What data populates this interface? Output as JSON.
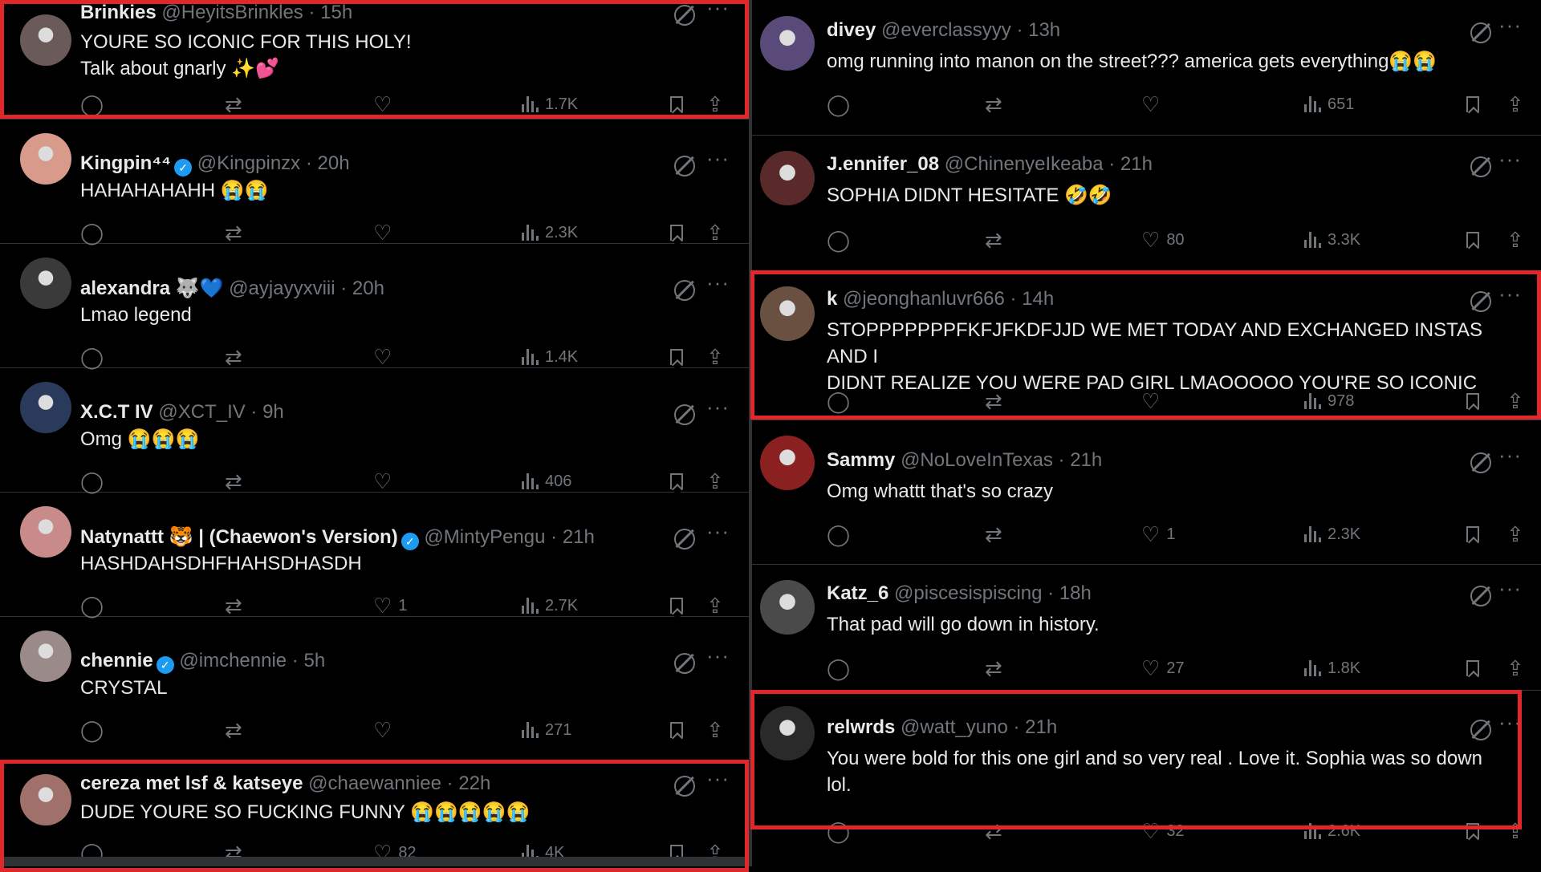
{
  "left_tweets": [
    {
      "name": "Brinkies",
      "verified": false,
      "handle": "@HeyitsBrinkles",
      "time": "15h",
      "lines": [
        "YOURE SO ICONIC FOR THIS HOLY!",
        "Talk about gnarly ✨💕"
      ],
      "replies": "",
      "retweets": "",
      "likes": "",
      "views": "1.7K",
      "avatar_color": "#6a5a5a"
    },
    {
      "name": "Kingpin⁴⁴",
      "verified": true,
      "handle": "@Kingpinzx",
      "time": "20h",
      "lines": [
        "HAHAHAHAHH 😭😭"
      ],
      "replies": "",
      "retweets": "",
      "likes": "",
      "views": "2.3K",
      "avatar_color": "#d89a8a"
    },
    {
      "name": "alexandra 🐺💙",
      "verified": false,
      "handle": "@ayjayyxviii",
      "time": "20h",
      "lines": [
        "Lmao legend"
      ],
      "replies": "",
      "retweets": "",
      "likes": "",
      "views": "1.4K",
      "avatar_color": "#3a3a3a"
    },
    {
      "name": "X.C.T IV",
      "verified": false,
      "handle": "@XCT_IV",
      "time": "9h",
      "lines": [
        "Omg 😭😭😭"
      ],
      "replies": "",
      "retweets": "",
      "likes": "",
      "views": "406",
      "avatar_color": "#2a3a5a"
    },
    {
      "name": "Natynattt 🐯 | (Chaewon's Version)",
      "verified": true,
      "handle": "@MintyPengu",
      "time": "21h",
      "lines": [
        "HASHDAHSDHFHAHSDHASDH"
      ],
      "replies": "",
      "retweets": "",
      "likes": "1",
      "views": "2.7K",
      "avatar_color": "#c98a8a"
    },
    {
      "name": "chennie",
      "verified": true,
      "handle": "@imchennie",
      "time": "5h",
      "lines": [
        "CRYSTAL"
      ],
      "replies": "",
      "retweets": "",
      "likes": "",
      "views": "271",
      "avatar_color": "#9a8a8a"
    },
    {
      "name": "cereza met lsf & katseye",
      "verified": false,
      "handle": "@chaewanniee",
      "time": "22h",
      "lines": [
        "DUDE YOURE SO FUCKING FUNNY 😭😭😭😭😭"
      ],
      "replies": "",
      "retweets": "",
      "likes": "82",
      "views": "4K",
      "avatar_color": "#a0706a"
    }
  ],
  "right_tweets": [
    {
      "name": "divey",
      "verified": false,
      "handle": "@everclassyyy",
      "time": "13h",
      "lines": [
        "omg running into manon on the street??? america gets everything😭😭"
      ],
      "replies": "",
      "retweets": "",
      "likes": "",
      "views": "651",
      "avatar_color": "#5a4a7a"
    },
    {
      "name": "J.ennifer_08",
      "verified": false,
      "handle": "@ChinenyeIkeaba",
      "time": "21h",
      "lines": [
        "SOPHIA DIDNT HESITATE 🤣🤣"
      ],
      "replies": "",
      "retweets": "",
      "likes": "80",
      "views": "3.3K",
      "avatar_color": "#5a2a2a"
    },
    {
      "name": "k",
      "verified": false,
      "handle": "@jeonghanluvr666",
      "time": "14h",
      "lines": [
        "STOPPPPPPPFKFJFKDFJJD WE MET TODAY AND EXCHANGED INSTAS AND I",
        "DIDNT REALIZE YOU WERE PAD GIRL LMAOOOOO YOU'RE SO ICONIC"
      ],
      "replies": "",
      "retweets": "",
      "likes": "",
      "views": "978",
      "avatar_color": "#6a5040"
    },
    {
      "name": "Sammy",
      "verified": false,
      "handle": "@NoLoveInTexas",
      "time": "21h",
      "lines": [
        "Omg whattt that's so crazy"
      ],
      "replies": "",
      "retweets": "",
      "likes": "1",
      "views": "2.3K",
      "avatar_color": "#8a2020"
    },
    {
      "name": "Katz_6",
      "verified": false,
      "handle": "@piscesispiscing",
      "time": "18h",
      "lines": [
        "That pad will go down in history."
      ],
      "replies": "",
      "retweets": "",
      "likes": "27",
      "views": "1.8K",
      "avatar_color": "#4a4a4a"
    },
    {
      "name": "relwrds",
      "verified": false,
      "handle": "@watt_yuno",
      "time": "21h",
      "lines": [
        "You were bold for this one girl and so very real . Love it. Sophia was so down",
        "lol."
      ],
      "replies": "",
      "retweets": "",
      "likes": "32",
      "views": "2.6K",
      "avatar_color": "#2a2a2a"
    }
  ],
  "colors": {
    "highlight": "#e0282c",
    "verified": "#1d9bf0",
    "muted": "#71767b",
    "text": "#e7e9ea",
    "border": "#2f3336"
  },
  "icons": {
    "reply": "reply-icon",
    "retweet": "retweet-icon",
    "like": "like-icon",
    "views": "views-icon",
    "bookmark": "bookmark-icon",
    "share": "share-icon",
    "grok": "grok-icon",
    "more": "more-icon"
  }
}
